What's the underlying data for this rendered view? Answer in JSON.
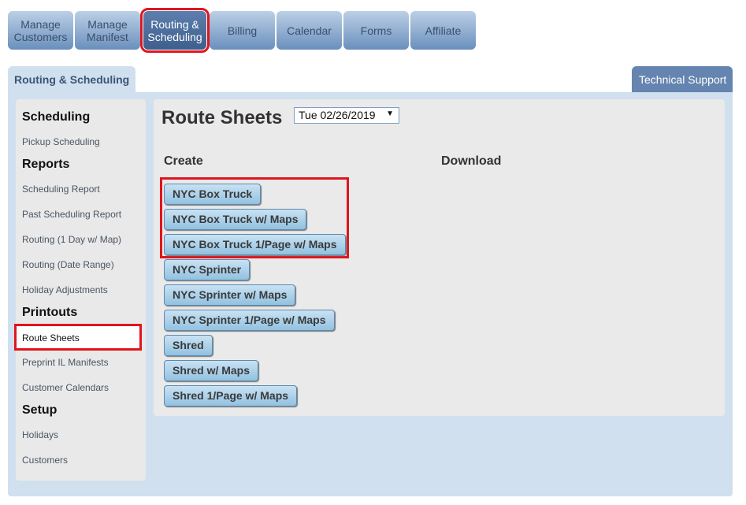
{
  "topnav": [
    {
      "label": "Manage Customers",
      "l1": "Manage",
      "l2": "Customers"
    },
    {
      "label": "Manage Manifest",
      "l1": "Manage",
      "l2": "Manifest"
    },
    {
      "label": "Routing & Scheduling",
      "l1": "Routing &",
      "l2": "Scheduling",
      "active": true
    },
    {
      "label": "Billing"
    },
    {
      "label": "Calendar"
    },
    {
      "label": "Forms"
    },
    {
      "label": "Affiliate"
    }
  ],
  "section_tab": "Routing & Scheduling",
  "support_tab": "Technical Support",
  "sidebar": {
    "groups": [
      {
        "heading": "Scheduling",
        "items": [
          "Pickup Scheduling"
        ]
      },
      {
        "heading": "Reports",
        "items": [
          "Scheduling Report",
          "Past Scheduling Report",
          "Routing (1 Day w/ Map)",
          "Routing (Date Range)",
          "Holiday Adjustments"
        ]
      },
      {
        "heading": "Printouts",
        "items": [
          "Route Sheets",
          "Preprint IL Manifests",
          "Customer Calendars"
        ]
      },
      {
        "heading": "Setup",
        "items": [
          "Holidays",
          "Customers"
        ]
      }
    ],
    "selected": "Route Sheets"
  },
  "main": {
    "title": "Route Sheets",
    "date_select": {
      "value": "Tue 02/26/2019",
      "arrow": "▼"
    },
    "create_label": "Create",
    "download_label": "Download",
    "buttons": [
      "NYC Box Truck",
      "NYC Box Truck w/ Maps",
      "NYC Box Truck 1/Page w/ Maps",
      "NYC Sprinter",
      "NYC Sprinter w/ Maps",
      "NYC Sprinter 1/Page w/ Maps",
      "Shred",
      "Shred w/ Maps",
      "Shred 1/Page w/ Maps"
    ]
  }
}
